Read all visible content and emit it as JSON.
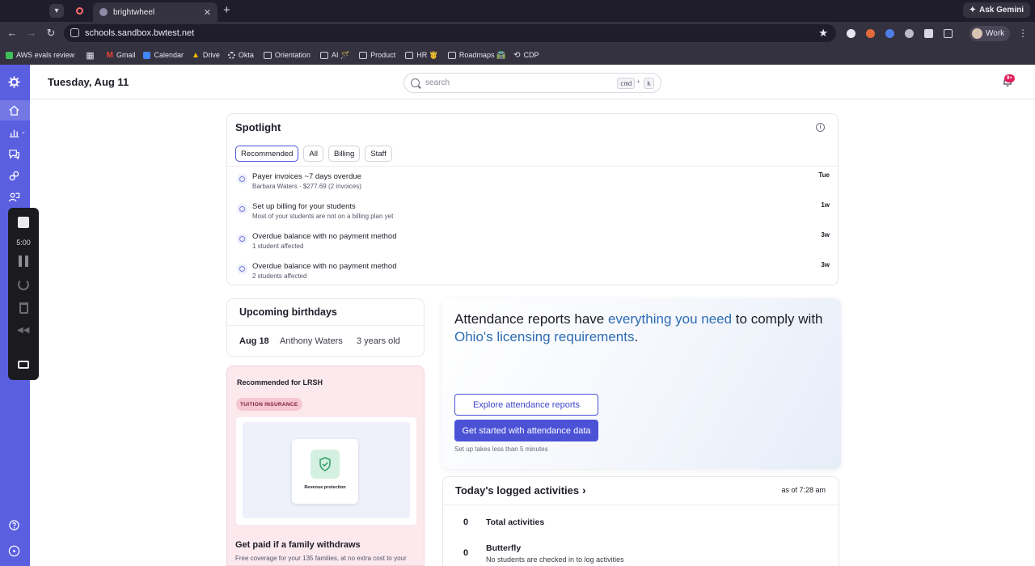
{
  "browser": {
    "tab_title": "brightwheel",
    "url": "schools.sandbox.bwtest.net",
    "ask_gemini": "Ask Gemini",
    "profile": "Work",
    "bookmarks": [
      "AWS evals review",
      "Gmail",
      "Calendar",
      "Drive",
      "Okta",
      "Orientation",
      "AI 🪄",
      "Product",
      "HR 🤴",
      "Roadmaps 🛣️",
      "CDP"
    ]
  },
  "recorder": {
    "time": "5:00"
  },
  "header": {
    "date": "Tuesday, Aug 11",
    "search_placeholder": "search",
    "kbd_cmd": "cmd",
    "kbd_plus": "+",
    "kbd_k": "k",
    "notif_badge": "9+"
  },
  "spotlight": {
    "title": "Spotlight",
    "info_glyph": "i",
    "filters": [
      "Recommended",
      "All",
      "Billing",
      "Staff"
    ],
    "items": [
      {
        "title": "Payer invoices ~7 days overdue",
        "sub": "Barbara Waters · $277.69 (2 invoices)",
        "time": "Tue"
      },
      {
        "title": "Set up billing for your students",
        "sub": "Most of your students are not on a billing plan yet",
        "time": "1w"
      },
      {
        "title": "Overdue balance with no payment method",
        "sub": "1 student affected",
        "time": "3w"
      },
      {
        "title": "Overdue balance with no payment method",
        "sub": "2 students affected",
        "time": "3w"
      }
    ]
  },
  "birthdays": {
    "title": "Upcoming birthdays",
    "date": "Aug 18",
    "name": "Anthony Waters",
    "age": "3 years old"
  },
  "promo": {
    "label": "Recommended for LRSH",
    "pill": "TUITION INSURANCE",
    "image_caption": "Revenue protection",
    "headline": "Get paid if a family withdraws",
    "sub": "Free coverage for your 135 families, at no extra cost to your"
  },
  "hero": {
    "text_1": "Attendance reports have ",
    "text_hl1": "everything you need",
    "text_2": " to comply with ",
    "text_hl2": "Ohio's licensing requirements",
    "text_3": ".",
    "btn_explore": "Explore attendance reports",
    "btn_start": "Get started with attendance data",
    "note": "Set up takes less than 5 minutes"
  },
  "activities": {
    "title": "Today's logged activities",
    "chevron": "›",
    "as_of": "as of 7:28 am",
    "total_count": "0",
    "total_label": "Total activities",
    "butterfly_count": "0",
    "butterfly_label": "Butterfly",
    "butterfly_sub": "No students are checked in to log activities"
  },
  "colors": {
    "rail": "#5a5fe0",
    "primary": "#4b52d6",
    "highlight_text": "#2d6cb3",
    "badge": "#e01e5a"
  }
}
